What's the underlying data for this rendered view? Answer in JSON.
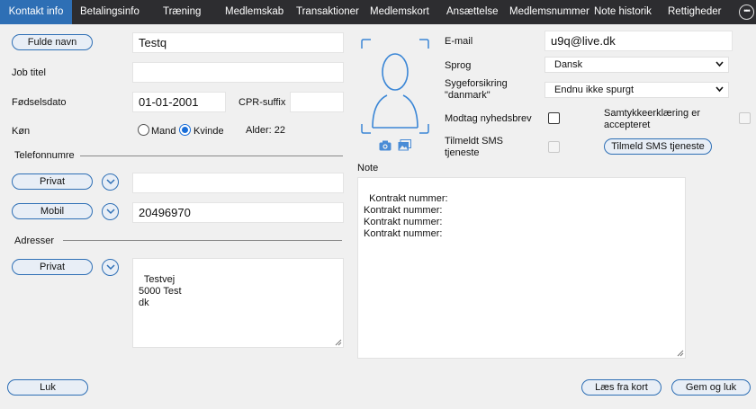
{
  "tabs": [
    {
      "label": "Kontakt info",
      "active": true
    },
    {
      "label": "Betalingsinfo"
    },
    {
      "label": "Træning"
    },
    {
      "label": "Medlemskab"
    },
    {
      "label": "Transaktioner"
    },
    {
      "label": "Medlemskort"
    },
    {
      "label": "Ansættelse"
    },
    {
      "label": "Medlemsnummer"
    },
    {
      "label": "Note historik"
    },
    {
      "label": "Rettigheder"
    }
  ],
  "more_icon": "more-dots-icon",
  "form": {
    "fullname_button": "Fulde navn",
    "fullname_value": "Testq",
    "jobtitle_label": "Job titel",
    "jobtitle_value": "",
    "birthdate_label": "Fødselsdato",
    "birthdate_value": "01-01-2001",
    "cpr_label": "CPR-suffix",
    "cpr_value": "",
    "gender_label": "Køn",
    "gender_male": "Mand",
    "gender_female": "Kvinde",
    "gender_selected": "Kvinde",
    "age_text": "Alder: 22"
  },
  "phones": {
    "section_title": "Telefonnumre",
    "items": [
      {
        "type": "Privat",
        "value": ""
      },
      {
        "type": "Mobil",
        "value": "20496970"
      }
    ]
  },
  "addresses": {
    "section_title": "Adresser",
    "items": [
      {
        "type": "Privat",
        "value": "Testvej\n5000 Test\ndk"
      }
    ]
  },
  "photo": {
    "placeholder_icon": "user-silhouette-icon",
    "camera_icon": "camera-icon",
    "gallery_icon": "image-gallery-icon"
  },
  "right": {
    "email_label": "E-mail",
    "email_value": "u9q@live.dk",
    "language_label": "Sprog",
    "language_value": "Dansk",
    "insurance_label": "Sygeforsikring \"danmark\"",
    "insurance_value": "Endnu ikke spurgt",
    "newsletter_label": "Modtag nyhedsbrev",
    "consent_label": "Samtykkeerklæring er accepteret",
    "sms_label": "Tilmeldt SMS tjeneste",
    "sms_button": "Tilmeld SMS tjeneste"
  },
  "note": {
    "label": "Note",
    "value": "Kontrakt nummer:\nKontrakt nummer:\nKontrakt nummer:\nKontrakt nummer:"
  },
  "footer": {
    "close_button": "Luk",
    "read_card_button": "Læs fra kort",
    "save_close_button": "Gem og luk"
  },
  "colors": {
    "tabbar": "#2d2d30",
    "tab_active": "#2e6fb5",
    "accent": "#2e6fb5",
    "background": "#f0f0f0"
  }
}
